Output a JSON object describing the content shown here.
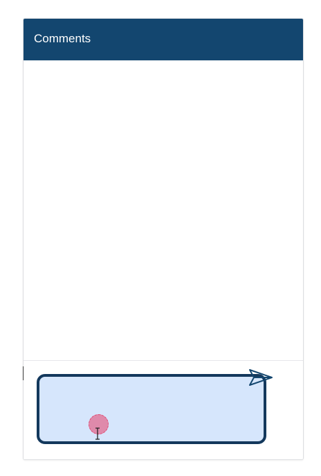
{
  "panel": {
    "title": "Comments"
  },
  "composer": {
    "input_value": "",
    "placeholder": ""
  },
  "colors": {
    "header_bg": "#13466f",
    "input_bg": "#d6e6fc",
    "input_border": "#13385c",
    "send_icon": "#13466f",
    "click_indicator": "#e2668c"
  },
  "icons": {
    "send": "send-icon",
    "cursor": "text-cursor-icon"
  }
}
